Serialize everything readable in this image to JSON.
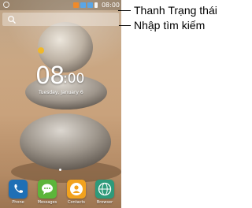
{
  "status_bar": {
    "time": "08:00",
    "icons": [
      "settings-circle-icon",
      "notification-icon",
      "wifi-icon",
      "signal-icon",
      "battery-icon"
    ]
  },
  "search_bar": {
    "icon": "search-icon"
  },
  "clock": {
    "hour": "08",
    "minute": ":00",
    "date": "Tuesday, January 6"
  },
  "dock": {
    "apps": [
      {
        "label": "Phone",
        "icon": "phone-icon",
        "color": "#1f6fb5"
      },
      {
        "label": "Messages",
        "icon": "messages-icon",
        "color": "#5cb53a"
      },
      {
        "label": "Contacts",
        "icon": "contacts-icon",
        "color": "#f2a21e"
      },
      {
        "label": "Browser",
        "icon": "browser-icon",
        "color": "#2e9a7a"
      }
    ]
  },
  "callouts": {
    "status_bar": "Thanh Trạng thái",
    "search": "Nhập tìm kiếm"
  }
}
